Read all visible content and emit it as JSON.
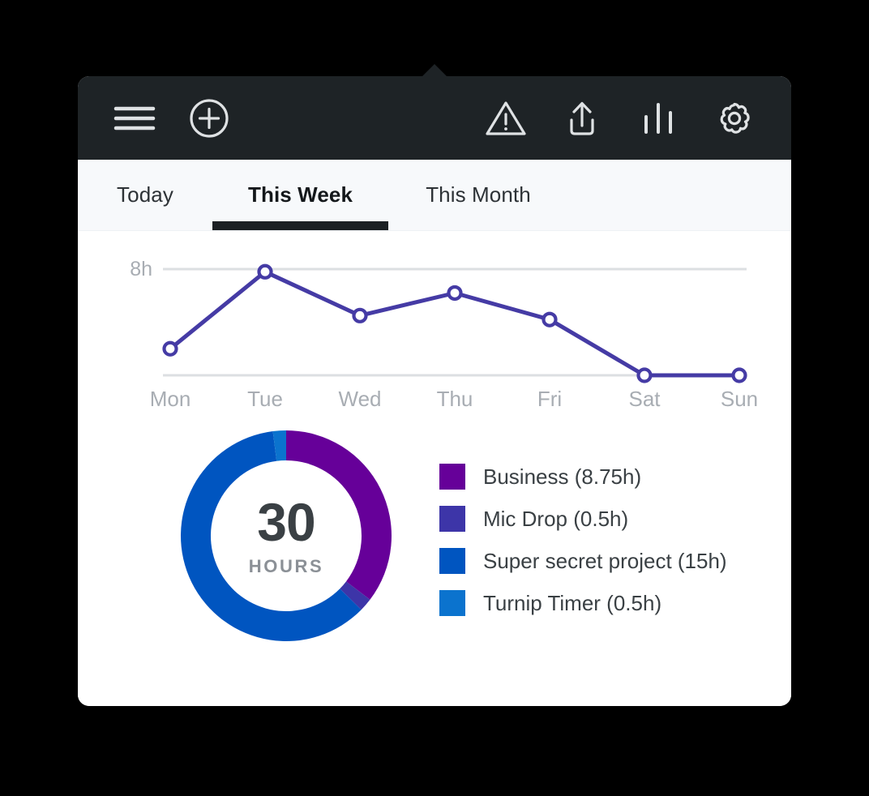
{
  "toolbar": {
    "left_buttons": [
      {
        "name": "menu",
        "icon": "hamburger-icon",
        "label": "Menu"
      },
      {
        "name": "add",
        "icon": "plus-circle-icon",
        "label": "Add entry"
      }
    ],
    "right_buttons": [
      {
        "name": "alert",
        "icon": "warning-triangle-icon",
        "label": "Alerts"
      },
      {
        "name": "export",
        "icon": "upload-icon",
        "label": "Export"
      },
      {
        "name": "reports",
        "icon": "bar-chart-icon",
        "label": "Reports"
      },
      {
        "name": "settings",
        "icon": "gear-icon",
        "label": "Settings"
      }
    ],
    "background": "#1e2326",
    "icon_color": "#dfe2e4"
  },
  "tabs": {
    "items": [
      {
        "label": "Today",
        "active": false
      },
      {
        "label": "This Week",
        "active": true
      },
      {
        "label": "This Month",
        "active": false
      }
    ],
    "indicator_color": "#1c2023",
    "background": "#f7f9fb"
  },
  "summary": {
    "total_value": "30",
    "total_unit": "HOURS"
  },
  "chart_data": [
    {
      "type": "line",
      "title": "",
      "xlabel": "",
      "ylabel": "",
      "categories": [
        "Mon",
        "Tue",
        "Wed",
        "Thu",
        "Fri",
        "Sat",
        "Sun"
      ],
      "values": [
        2.0,
        7.8,
        4.5,
        6.2,
        4.2,
        0,
        0
      ],
      "ylim": [
        0,
        8
      ],
      "y_tick_labels": [
        "8h"
      ],
      "y_ticks": [
        8
      ],
      "grid": true,
      "gridlines": [
        0,
        8
      ],
      "legend": "none",
      "line_color": "#453ba5",
      "marker": "open-circle",
      "marker_fill": "#ffffff",
      "axis_label_color": "#a8adb3",
      "gridline_color": "#dcdfe2"
    },
    {
      "type": "pie",
      "variant": "donut",
      "title": "",
      "center_label": "30",
      "center_sublabel": "HOURS",
      "total": 30,
      "unit": "h",
      "start_angle_deg": -90,
      "labels": [
        "Business",
        "Mic Drop",
        "Super secret project",
        "Turnip Timer"
      ],
      "values": [
        8.75,
        0.5,
        15.0,
        0.5
      ],
      "legend_labels": [
        "Business (8.75h)",
        "Mic Drop (0.5h)",
        "Super secret project (15h)",
        "Turnip Timer (0.5h)"
      ],
      "colors": [
        "#660099",
        "#3d35a8",
        "#0055c0",
        "#0b73ce"
      ],
      "legend_position": "right"
    }
  ]
}
